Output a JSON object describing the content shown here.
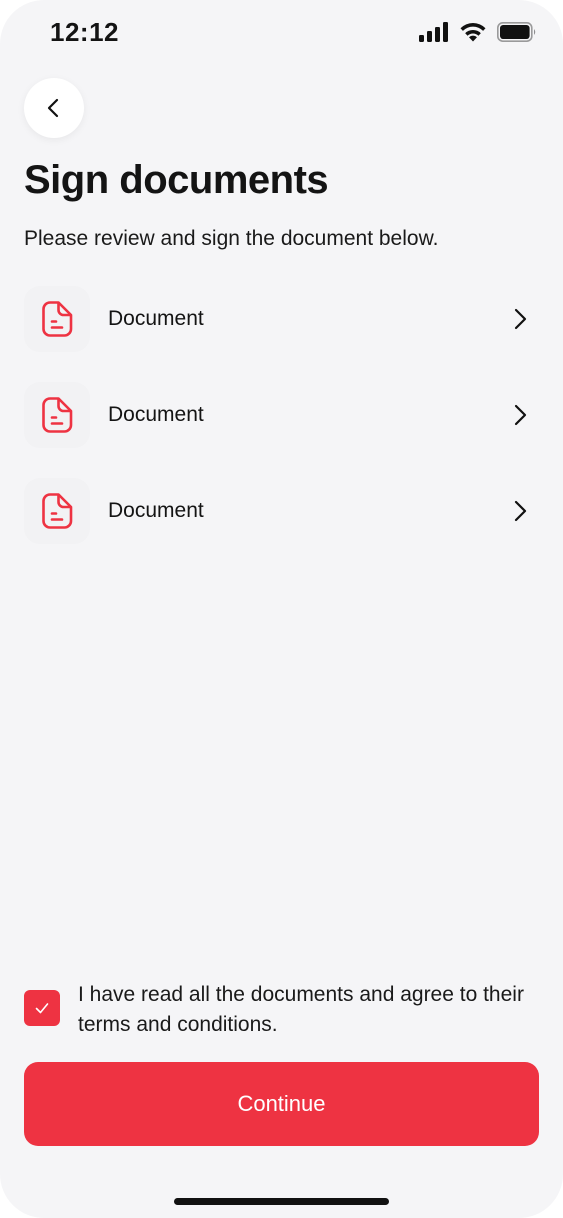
{
  "status_bar": {
    "time": "12:12",
    "icons": [
      "signal-icon",
      "wifi-icon",
      "battery-icon"
    ]
  },
  "header": {
    "back_icon": "chevron-left-icon",
    "title": "Sign documents",
    "subtitle": "Please review and sign the document below."
  },
  "documents": [
    {
      "label": "Document",
      "icon": "document-icon"
    },
    {
      "label": "Document",
      "icon": "document-icon"
    },
    {
      "label": "Document",
      "icon": "document-icon"
    }
  ],
  "agreement": {
    "checked": true,
    "text": "I have read all the documents and agree to their terms and conditions."
  },
  "continue_label": "Continue",
  "colors": {
    "accent": "#ee3342",
    "background": "#f5f5f7",
    "text": "#141414"
  }
}
